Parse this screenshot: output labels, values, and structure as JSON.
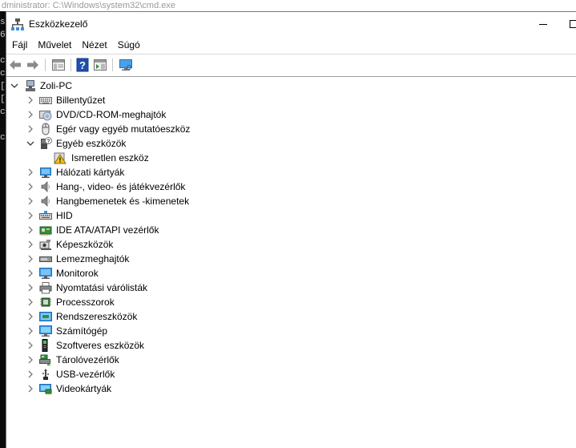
{
  "background": {
    "title_text": "dministrator: C:\\Windows\\system32\\cmd.exe",
    "side_chars": [
      "s",
      "6",
      "",
      "c",
      "c",
      "[",
      "[",
      "c",
      "",
      "c"
    ]
  },
  "window": {
    "title": "Eszközkezelő",
    "icon": "device-manager-icon"
  },
  "menu": [
    "Fájl",
    "Művelet",
    "Nézet",
    "Súgó"
  ],
  "toolbar": {
    "buttons": [
      "back-arrow-icon",
      "forward-arrow-icon",
      "properties-sheet-icon",
      "help-icon",
      "action-pane-icon",
      "monitor-scan-icon"
    ]
  },
  "tree": {
    "root": {
      "label": "Zoli-PC",
      "expanded": true,
      "icon": "computer-icon"
    },
    "items": [
      {
        "label": "Billentyűzet",
        "icon": "keyboard-icon",
        "expanded": false
      },
      {
        "label": "DVD/CD-ROM-meghajtók",
        "icon": "dvd-drive-icon",
        "expanded": false
      },
      {
        "label": "Egér vagy egyéb mutatóeszköz",
        "icon": "mouse-icon",
        "expanded": false
      },
      {
        "label": "Egyéb eszközök",
        "icon": "unknown-device-icon",
        "expanded": true,
        "children": [
          {
            "label": "Ismeretlen eszköz",
            "icon": "warning-device-icon"
          }
        ]
      },
      {
        "label": "Hálózati kártyák",
        "icon": "network-adapter-icon",
        "expanded": false
      },
      {
        "label": "Hang-, video- és játékvezérlők",
        "icon": "speaker-icon",
        "expanded": false
      },
      {
        "label": "Hangbemenetek és -kimenetek",
        "icon": "speaker-icon",
        "expanded": false
      },
      {
        "label": "HID",
        "icon": "hid-icon",
        "expanded": false
      },
      {
        "label": "IDE ATA/ATAPI vezérlők",
        "icon": "ide-controller-icon",
        "expanded": false
      },
      {
        "label": "Képeszközök",
        "icon": "camera-icon",
        "expanded": false
      },
      {
        "label": "Lemezmeghajtók",
        "icon": "disk-drive-icon",
        "expanded": false
      },
      {
        "label": "Monitorok",
        "icon": "monitor-icon",
        "expanded": false
      },
      {
        "label": "Nyomtatási várólisták",
        "icon": "printer-icon",
        "expanded": false
      },
      {
        "label": "Processzorok",
        "icon": "processor-icon",
        "expanded": false
      },
      {
        "label": "Rendszereszközök",
        "icon": "system-device-icon",
        "expanded": false
      },
      {
        "label": "Számítógép",
        "icon": "computer-monitor-icon",
        "expanded": false
      },
      {
        "label": "Szoftveres eszközök",
        "icon": "software-device-icon",
        "expanded": false
      },
      {
        "label": "Tárolóvezérlők",
        "icon": "storage-controller-icon",
        "expanded": false
      },
      {
        "label": "USB-vezérlők",
        "icon": "usb-icon",
        "expanded": false
      },
      {
        "label": "Videokártyák",
        "icon": "display-adapter-icon",
        "expanded": false
      }
    ]
  },
  "colors": {
    "accent_blue": "#2f7fd6",
    "warning_yellow": "#f4c21b",
    "console_bg": "#0c0c0c"
  }
}
